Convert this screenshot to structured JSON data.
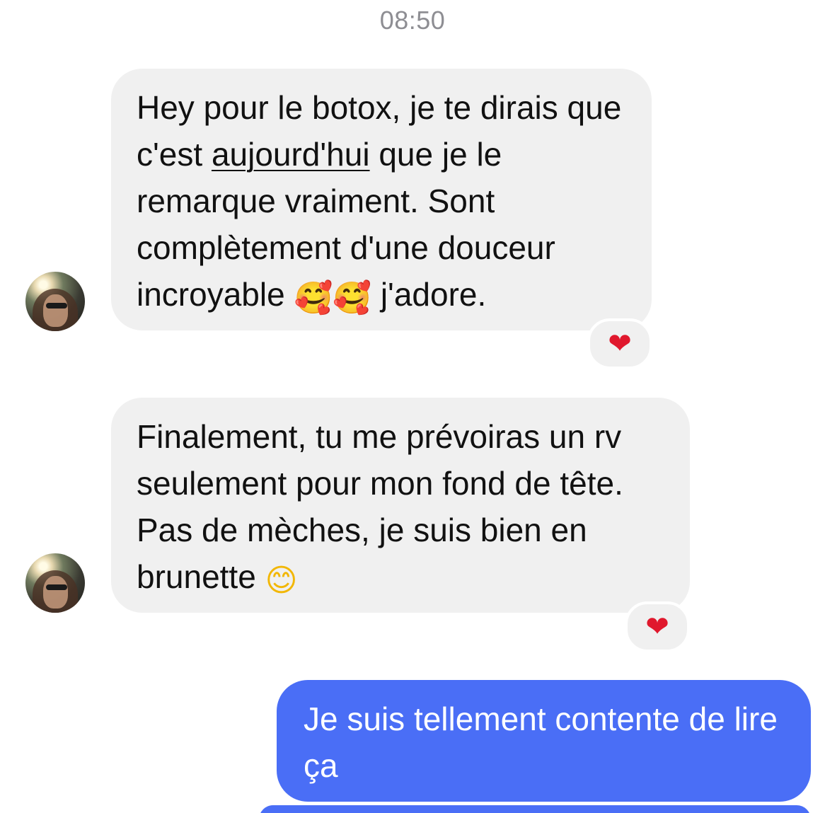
{
  "timestamp": "08:50",
  "messages": [
    {
      "direction": "incoming",
      "segments": {
        "t1": "Hey pour le botox, je te dirais que c'est ",
        "link": "aujourd'hui",
        "t2": " que je le remarque vraiment. Sont complètement d'une douceur incroyable ",
        "emoji1": "🥰",
        "emoji2": "🥰",
        "t3": " j'adore."
      },
      "reaction": "❤"
    },
    {
      "direction": "incoming",
      "segments": {
        "t1": "Finalement, tu me prévoiras un rv seulement pour mon fond de tête. Pas de mèches, je suis bien en brunette ",
        "emoji1": "😊"
      },
      "reaction": "❤"
    },
    {
      "direction": "outgoing",
      "text": "Je suis tellement contente de lire ça"
    }
  ],
  "colors": {
    "incoming_bubble": "#f0f0f0",
    "outgoing_bubble": "#4a6ef6",
    "reaction_heart": "#e0182d",
    "timestamp": "#8e8e93"
  },
  "icons": {
    "avatar": "contact-avatar",
    "reaction": "red-heart-icon"
  }
}
